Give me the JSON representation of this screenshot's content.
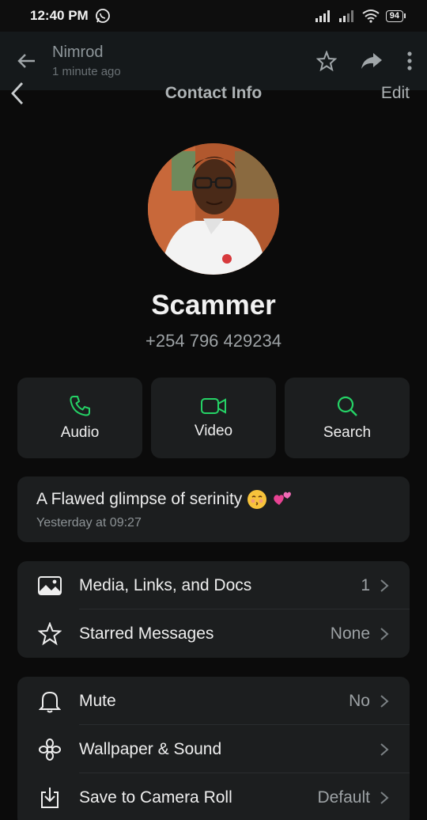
{
  "status": {
    "time": "12:40 PM",
    "battery": "94"
  },
  "chat": {
    "name": "Nimrod",
    "last_seen": "1 minute ago"
  },
  "nav": {
    "title": "Contact Info",
    "edit": "Edit"
  },
  "profile": {
    "name": "Scammer",
    "phone": "+254 796 429234"
  },
  "actions": [
    {
      "label": "Audio",
      "icon": "phone-icon"
    },
    {
      "label": "Video",
      "icon": "video-icon"
    },
    {
      "label": "Search",
      "icon": "search-icon"
    }
  ],
  "about": {
    "text": "A Flawed glimpse of serinity",
    "date": "Yesterday at 09:27"
  },
  "group1": [
    {
      "label": "Media, Links, and Docs",
      "value": "1",
      "icon": "image-icon"
    },
    {
      "label": "Starred Messages",
      "value": "None",
      "icon": "star-icon"
    }
  ],
  "group2": [
    {
      "label": "Mute",
      "value": "No",
      "icon": "bell-icon"
    },
    {
      "label": "Wallpaper & Sound",
      "value": "",
      "icon": "flower-icon"
    },
    {
      "label": "Save to Camera Roll",
      "value": "Default",
      "icon": "download-icon"
    }
  ],
  "colors": {
    "accent": "#25d366",
    "background": "#0b0b0b",
    "card": "#1c1e1f"
  }
}
